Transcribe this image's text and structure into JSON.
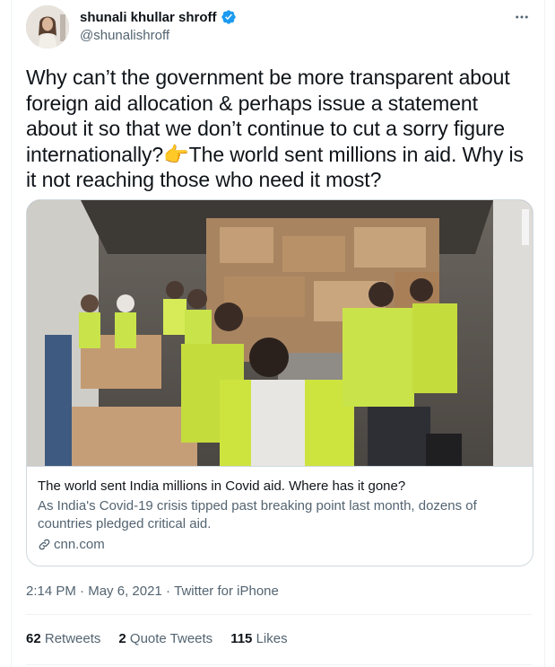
{
  "author": {
    "display_name": "shunali khullar shroff",
    "handle": "@shunalishroff"
  },
  "icons": {
    "verified": "verified-badge-icon",
    "more": "more-dots-icon",
    "link": "link-icon",
    "emoji": "backhand-index-pointing-right-emoji"
  },
  "tweet": {
    "text_before_emoji": "Why can’t the government be more transparent about foreign aid allocation & perhaps issue a statement about it so that we don’t continue to cut a sorry figure internationally?",
    "emoji": "👉",
    "text_after_emoji": "The world sent millions in aid. Why is it not reaching those who need it most?"
  },
  "card": {
    "title": "The world sent India millions in Covid aid. Where has it gone?",
    "description": "As India's Covid-19 crisis tipped past breaking point last month, dozens of countries pledged critical aid.",
    "domain": "cnn.com"
  },
  "meta": {
    "time": "2:14 PM",
    "sep1": " · ",
    "date": "May 6, 2021",
    "sep2": " · ",
    "source": "Twitter for iPhone"
  },
  "stats": {
    "retweets_count": "62",
    "retweets_label": "Retweets",
    "quotes_count": "2",
    "quotes_label": "Quote Tweets",
    "likes_count": "115",
    "likes_label": "Likes"
  },
  "colors": {
    "text_primary": "#0f1419",
    "text_secondary": "#536471",
    "verified_blue": "#1d9bf0",
    "border": "#cfd9de",
    "divider": "#eff3f4"
  }
}
